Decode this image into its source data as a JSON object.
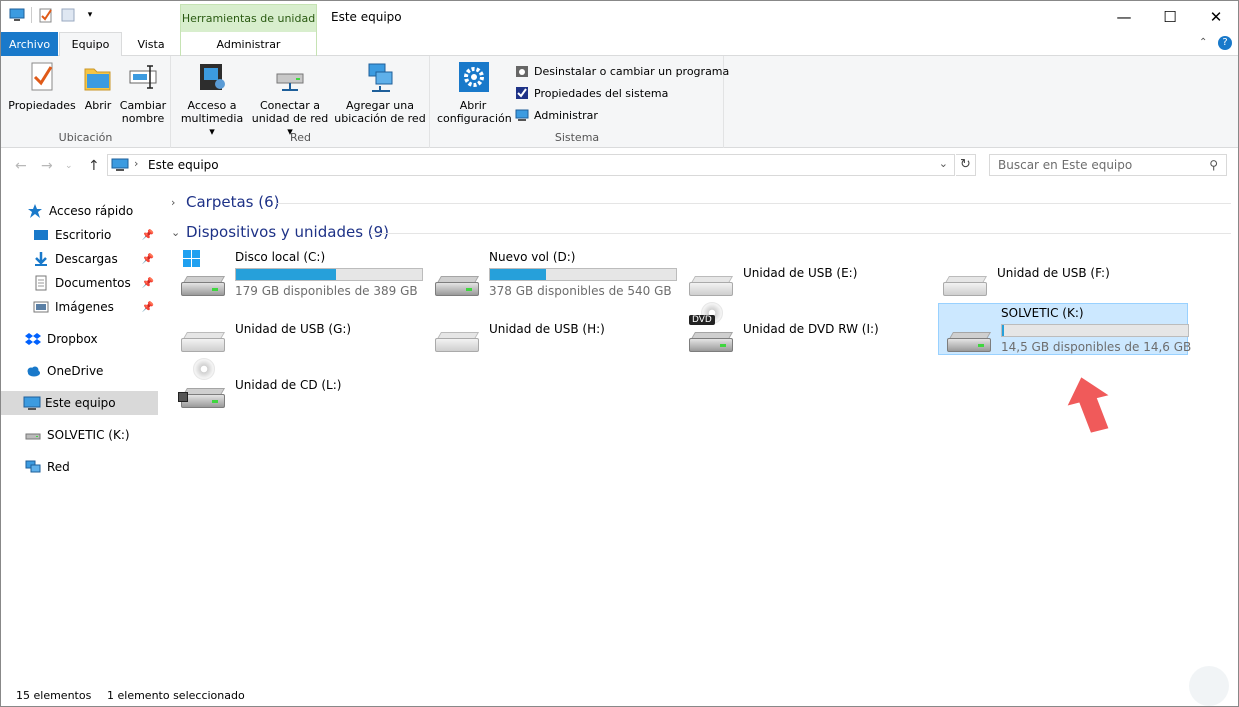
{
  "window": {
    "context_tab": "Herramientas de unidad",
    "title": "Este equipo",
    "controls": {
      "minimize": "—",
      "maximize": "☐",
      "close": "✕"
    }
  },
  "tabs": {
    "archivo": "Archivo",
    "equipo": "Equipo",
    "vista": "Vista",
    "administrar": "Administrar"
  },
  "ribbon": {
    "ubicacion": {
      "label": "Ubicación",
      "propiedades": "Propiedades",
      "abrir": "Abrir",
      "cambiar_nombre_1": "Cambiar",
      "cambiar_nombre_2": "nombre"
    },
    "red": {
      "label": "Red",
      "acceso_1": "Acceso a",
      "acceso_2": "multimedia ▾",
      "conectar_1": "Conectar a",
      "conectar_2": "unidad de red ▾",
      "agregar_1": "Agregar una",
      "agregar_2": "ubicación de red"
    },
    "sistema": {
      "label": "Sistema",
      "abrir_conf_1": "Abrir",
      "abrir_conf_2": "configuración",
      "desinstalar": "Desinstalar o cambiar un programa",
      "propiedades_sistema": "Propiedades del sistema",
      "administrar": "Administrar"
    }
  },
  "address": {
    "path": "Este equipo",
    "search_placeholder": "Buscar en Este equipo"
  },
  "navpane": [
    {
      "label": "Acceso rápido",
      "icon": "star-icon",
      "pinned": false
    },
    {
      "label": "Escritorio",
      "icon": "desktop-icon",
      "pinned": true
    },
    {
      "label": "Descargas",
      "icon": "download-icon",
      "pinned": true
    },
    {
      "label": "Documentos",
      "icon": "document-icon",
      "pinned": true
    },
    {
      "label": "Imágenes",
      "icon": "pictures-icon",
      "pinned": true
    },
    {
      "label": "Dropbox",
      "icon": "dropbox-icon",
      "pinned": false
    },
    {
      "label": "OneDrive",
      "icon": "cloud-icon",
      "pinned": false
    },
    {
      "label": "Este equipo",
      "icon": "computer-icon",
      "pinned": false,
      "selected": true
    },
    {
      "label": "SOLVETIC (K:)",
      "icon": "usb-drive-icon",
      "pinned": false
    },
    {
      "label": "Red",
      "icon": "network-icon",
      "pinned": false
    }
  ],
  "groups": {
    "carpetas": "Carpetas (6)",
    "dispositivos": "Dispositivos y unidades (9)"
  },
  "drives": [
    {
      "name": "Disco local (C:)",
      "free": "179 GB disponibles de 389 GB",
      "used_fraction": 0.54,
      "icon": "windows-drive-icon"
    },
    {
      "name": "Nuevo vol (D:)",
      "free": "378 GB disponibles de 540 GB",
      "used_fraction": 0.3,
      "icon": "hard-drive-icon"
    },
    {
      "name": "Unidad de USB (E:)",
      "icon": "usb-drive-icon"
    },
    {
      "name": "Unidad de USB (F:)",
      "icon": "usb-drive-icon"
    },
    {
      "name": "Unidad de USB (G:)",
      "icon": "usb-drive-icon"
    },
    {
      "name": "Unidad de USB (H:)",
      "icon": "usb-drive-icon"
    },
    {
      "name": "Unidad de DVD RW (I:)",
      "icon": "dvd-drive-icon",
      "badge": "DVD"
    },
    {
      "name": "SOLVETIC (K:)",
      "free": "14,5 GB disponibles de 14,6 GB",
      "used_fraction": 0.01,
      "icon": "usb-drive-icon",
      "selected": true
    },
    {
      "name": "Unidad de CD (L:)",
      "icon": "cd-drive-icon"
    }
  ],
  "status": {
    "count": "15 elementos",
    "selected": "1 elemento seleccionado"
  },
  "colors": {
    "accent": "#1979ca",
    "selection": "#cce8ff",
    "progress": "#26a0da",
    "context_tab": "#d8eecd",
    "arrow": "#f05a5a"
  }
}
